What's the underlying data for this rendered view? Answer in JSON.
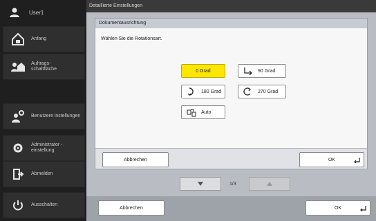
{
  "sidebar": {
    "user": "User1",
    "items": [
      {
        "label": "Anfang",
        "icon": "home-icon"
      },
      {
        "label": "Auftrags-\nschaltfläche",
        "icon": "job-buttons-icon"
      },
      {
        "label": "Benutzere instellungen",
        "icon": "user-settings-icon"
      },
      {
        "label": "Administrator -\neinstellung",
        "icon": "admin-settings-icon"
      },
      {
        "label": "Abmelden",
        "icon": "logout-icon"
      },
      {
        "label": "Ausschalten",
        "icon": "power-icon"
      }
    ]
  },
  "titlebar": "Detaillierte Einstellungen",
  "dialog": {
    "title": "Dokumentausrichtung",
    "prompt": "Wählen Sie die Rotationsart.",
    "options": {
      "deg0": "0 Grad",
      "deg90": "90 Grad",
      "deg180": "180 Grad",
      "deg270": "270 Grad",
      "auto": "Auto"
    },
    "selected": "0 Grad",
    "cancel": "Abbrechen",
    "ok": "OK"
  },
  "pager": {
    "text": "1/3"
  },
  "footer": {
    "cancel": "Abbrechen",
    "ok": "OK"
  },
  "colors": {
    "selected": "#ffe600"
  }
}
